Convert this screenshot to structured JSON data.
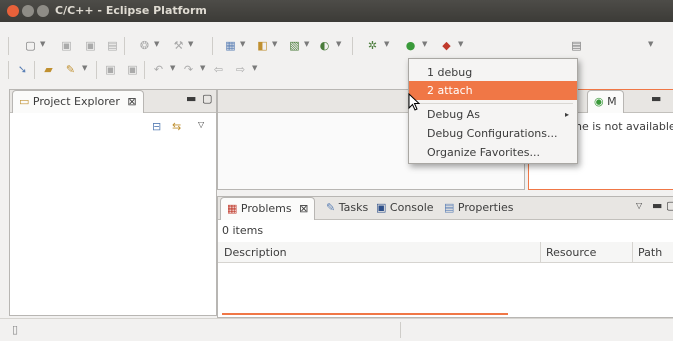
{
  "window": {
    "title": "C/C++ - Eclipse Platform"
  },
  "colors": {
    "close": "#e8613a",
    "min": "#b9b7b1",
    "max": "#b9b7b1",
    "accent": "#f07746"
  },
  "toolbar_icons": [
    "new-icon",
    "save-icon",
    "save-all-icon",
    "print-icon",
    "build-icon",
    "hammer-icon",
    "new-project-icon",
    "new-class-icon",
    "new-file-icon",
    "search-icon",
    "debug-icon",
    "run-icon",
    "external-tools-icon",
    "perspective-icon",
    "pin-icon",
    "open-folder-icon",
    "annotation-icon",
    "next-annotation-icon",
    "prev-annotation-icon",
    "back-icon",
    "forward-icon"
  ],
  "project_explorer": {
    "tab_label": "Project Explorer",
    "close_glyph": "⊠"
  },
  "menu": {
    "items": [
      {
        "label": "1 debug",
        "mnemonic": "1"
      },
      {
        "label": "2 attach",
        "mnemonic": "2"
      },
      {
        "label": "Debug As",
        "submenu_arrow": "▸"
      },
      {
        "label": "Debug Configurations..."
      },
      {
        "label": "Organize Favorites..."
      }
    ]
  },
  "outline": {
    "tab_label": "M",
    "message_fragment": "ne is not available"
  },
  "bottom": {
    "tabs": [
      {
        "label": "Problems",
        "close_glyph": "⊠"
      },
      {
        "label": "Tasks"
      },
      {
        "label": "Console"
      },
      {
        "label": "Properties"
      }
    ],
    "items_count": "0 items",
    "columns": [
      "Description",
      "Resource",
      "Path"
    ]
  }
}
